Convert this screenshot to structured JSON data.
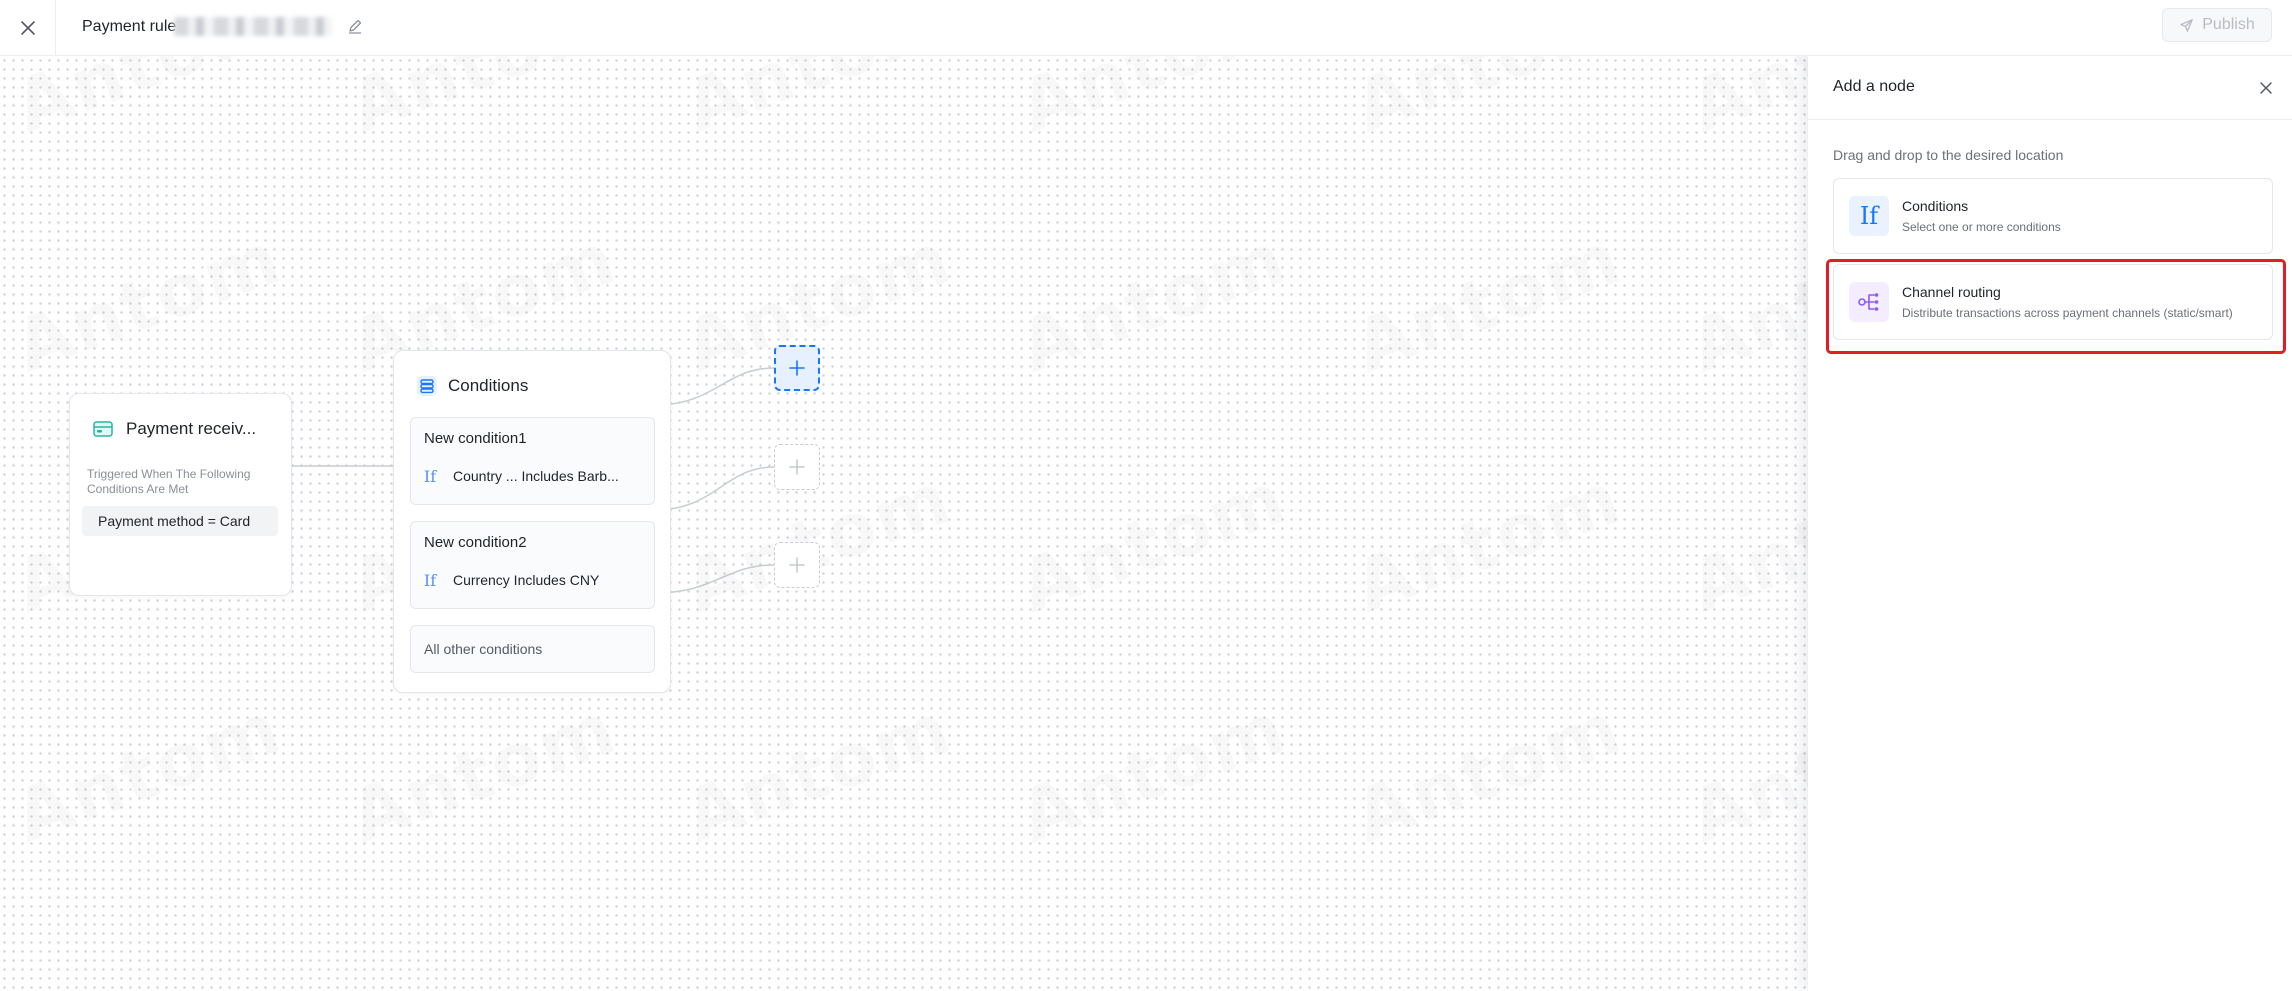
{
  "header": {
    "rule_title_prefix": "Payment rule",
    "publish_label": "Publish"
  },
  "flow": {
    "trigger": {
      "title": "Payment receiv...",
      "description": "Triggered When The Following Conditions Are Met",
      "criteria": "Payment method  =  Card"
    },
    "conditions_node": {
      "title": "Conditions",
      "items": [
        {
          "name": "New condition1",
          "expression": "Country ...  Includes  Barb..."
        },
        {
          "name": "New condition2",
          "expression": "Currency  Includes  CNY"
        }
      ],
      "other": "All other conditions"
    }
  },
  "panel": {
    "title": "Add a node",
    "hint": "Drag and drop to the desired location",
    "cards": [
      {
        "title": "Conditions",
        "description": "Select one or more conditions",
        "icon": "if-icon"
      },
      {
        "title": "Channel routing",
        "description": "Distribute transactions across payment channels (static/smart)",
        "icon": "channel-routing-icon"
      }
    ]
  },
  "watermark": "Antom",
  "colors": {
    "primary": "#1677ff",
    "trigger_icon": "#26b5a3",
    "routing_icon": "#8b5cf6",
    "highlight": "#e51c23"
  }
}
